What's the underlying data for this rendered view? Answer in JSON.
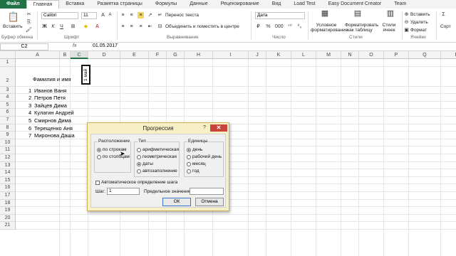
{
  "tabs": [
    "Файл",
    "Главная",
    "Вставка",
    "Разметка страницы",
    "Формулы",
    "Данные",
    "Рецензирование",
    "Вид",
    "Load Test",
    "Easy Document Creator",
    "Team"
  ],
  "ribbon": {
    "paste_label": "Вставить",
    "clipboard_label": "Буфер обмена",
    "font_name": "Calibri",
    "font_size": "11",
    "font_label": "Шрифт",
    "wrap_text": "Перенос текста",
    "merge_center": "Объединить и поместить в центре",
    "alignment_label": "Выравнивание",
    "number_format": "Дата",
    "number_label": "Число",
    "cond_format": "Условное форматирование",
    "format_table": "Форматировать как таблицу",
    "cell_styles": "Стили ячеек",
    "styles_label": "Стили",
    "insert": "Вставить",
    "delete": "Удалить",
    "format": "Формат",
    "cells_label": "Ячейки",
    "sort_label": "Сорт"
  },
  "formula_bar": {
    "name_box": "C2",
    "fx": "fx",
    "value": "01.05.2017"
  },
  "columns": [
    "A",
    "B",
    "C",
    "D",
    "E",
    "F",
    "G",
    "H",
    "I",
    "J",
    "K",
    "L",
    "M",
    "N",
    "O",
    "P",
    "Q",
    "R"
  ],
  "rows": [
    "1",
    "2",
    "3",
    "4",
    "5",
    "6",
    "7",
    "8",
    "9",
    "10",
    "11",
    "12",
    "13",
    "14",
    "15",
    "16",
    "17",
    "18",
    "19",
    "20",
    "21"
  ],
  "sheet": {
    "header_b2": "Фамилия и имя",
    "c2_value": "1 май",
    "people": [
      {
        "n": "1",
        "name": "Иванов Ваня"
      },
      {
        "n": "2",
        "name": "Петров Петя"
      },
      {
        "n": "3",
        "name": "Зайцев Дима"
      },
      {
        "n": "4",
        "name": "Кулагин Андрей"
      },
      {
        "n": "5",
        "name": "Смирнов Дима"
      },
      {
        "n": "6",
        "name": "Терещенко Аня"
      },
      {
        "n": "7",
        "name": "Миронова Даша"
      }
    ]
  },
  "dialog": {
    "title": "Прогрессия",
    "help": "?",
    "close": "✕",
    "location_title": "Расположение",
    "location_options": [
      "по строкам",
      "по столбцам"
    ],
    "type_title": "Тип",
    "type_options": [
      "арифметическая",
      "геометрическая",
      "даты",
      "автозаполнение"
    ],
    "units_title": "Единицы",
    "units_options": [
      "день",
      "рабочий день",
      "месяц",
      "год"
    ],
    "auto_step": "Автоматическое определение шага",
    "step_label": "Шаг:",
    "step_value": "1",
    "limit_label": "Предельное значение:",
    "limit_value": "",
    "ok": "ОК",
    "cancel": "Отмена"
  }
}
